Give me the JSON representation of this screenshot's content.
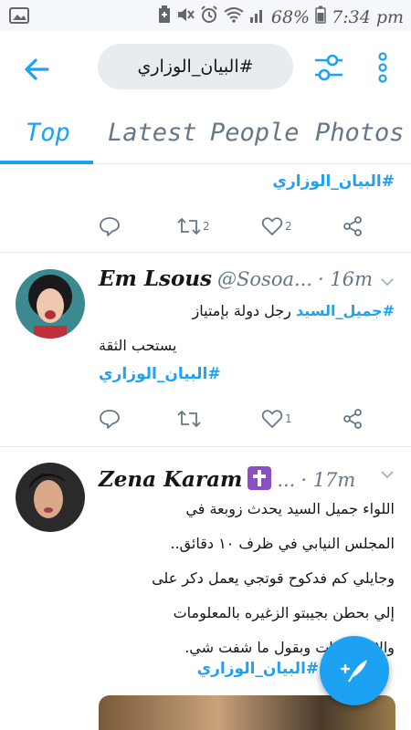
{
  "status_bar": {
    "battery_percent": "68%",
    "time": "7:34 pm"
  },
  "header": {
    "search_query": "#البيان_الوزاري"
  },
  "tabs": [
    {
      "label": "Top",
      "active": true
    },
    {
      "label": "Latest",
      "active": false
    },
    {
      "label": "People",
      "active": false
    },
    {
      "label": "Photos",
      "active": false
    }
  ],
  "tweets": [
    {
      "hashtag": "#البيان_الوزاري",
      "retweets": "2",
      "likes": "2"
    },
    {
      "name": "Em Lsous",
      "handle": "@Sosoa...",
      "time": "· 16m",
      "hashtag_inline": "#جميل_السيد",
      "text_line1": " رجل دولة بإمتياز",
      "text_line2": "يستحب الثقة",
      "hashtag": "#البيان_الوزاري",
      "likes": "1"
    },
    {
      "name": "Zena Karam",
      "name_emoji": "✝️",
      "handle": "...",
      "time": "· 17m",
      "lines": [
        "اللواء جميل السيد يحدث زوبعة في",
        "المجلس النيابي في ظرف ١٠ دقائق..",
        "وجايلي كم فدكوح قوتجي يعمل دكر على",
        "إلي بحطن بجيبتو الزغيره بالمعلومات",
        "والاستخبارات وبقول ما شفت شي."
      ],
      "hashtags_bottom": "#القوي #البيان_الوزاري"
    }
  ],
  "colors": {
    "accent": "#1da1f2",
    "muted": "#657786",
    "divider": "#e6ecf0"
  }
}
